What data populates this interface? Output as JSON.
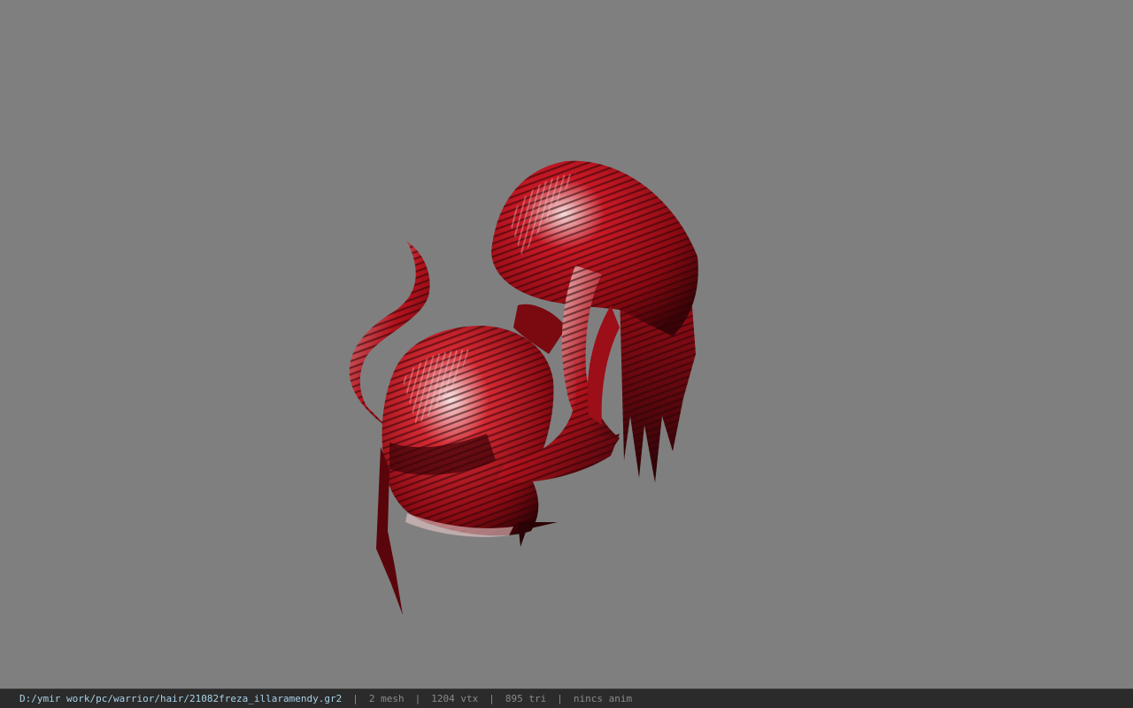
{
  "viewport": {
    "background": "#7f7f7f",
    "model": {
      "label": "",
      "primary_color": "#b0101c",
      "highlight_color": "#f2d6d6",
      "shadow_color": "#2a0306"
    }
  },
  "status_bar": {
    "file_path": "D:/ymir work/pc/warrior/hair/21082freza_illaramendy.gr2",
    "mesh_count": "2 mesh",
    "vertex_count": "1204 vtx",
    "triangle_count": "895 tri",
    "anim_status": "nincs anim"
  }
}
